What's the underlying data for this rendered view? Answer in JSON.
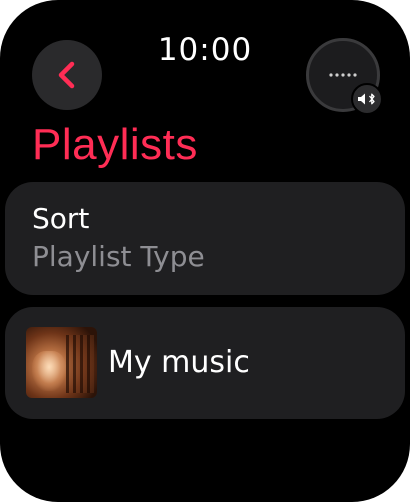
{
  "status": {
    "time": "10:00"
  },
  "header": {
    "back_icon": "chevron-left-icon",
    "now_playing_icon": "ellipsis-icon",
    "audio_badge_icon": "speaker-bluetooth-icon"
  },
  "page": {
    "title": "Playlists"
  },
  "sort": {
    "label": "Sort",
    "value": "Playlist Type"
  },
  "playlists": [
    {
      "name": "My music",
      "artwork": "album-artwork-image"
    }
  ],
  "colors": {
    "accent": "#ff2d55",
    "background": "#000000",
    "card": "#1f1f21",
    "secondary_text": "#8e8e93"
  }
}
